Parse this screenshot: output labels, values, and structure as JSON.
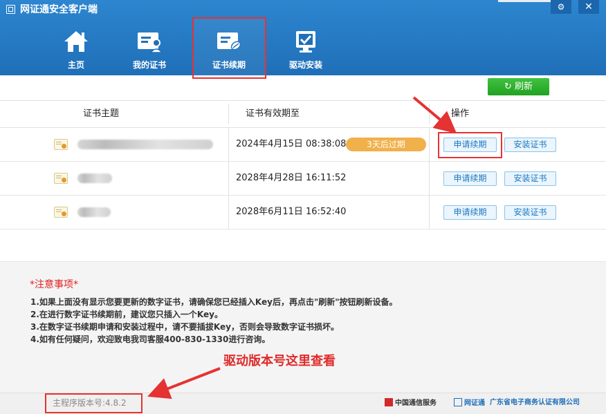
{
  "app": {
    "title": "网证通安全客户端"
  },
  "nav": [
    {
      "label": "主页",
      "icon": "home-icon"
    },
    {
      "label": "我的证书",
      "icon": "certificate-user-icon"
    },
    {
      "label": "证书续期",
      "icon": "certificate-renew-icon",
      "active": true
    },
    {
      "label": "驱动安装",
      "icon": "driver-install-icon"
    }
  ],
  "toolbar": {
    "refresh_label": "刷新"
  },
  "table": {
    "headers": [
      "证书主题",
      "证书有效期至",
      "操作"
    ],
    "rows": [
      {
        "expiry": "2024年4月15日 08:38:08",
        "badge": "3天后过期",
        "renew": "申请续期",
        "install": "安装证书"
      },
      {
        "expiry": "2028年4月28日 16:11:52",
        "renew": "申请续期",
        "install": "安装证书"
      },
      {
        "expiry": "2028年6月11日 16:52:40",
        "renew": "申请续期",
        "install": "安装证书"
      }
    ]
  },
  "notes": {
    "star": "*",
    "title": "注意事项",
    "lines": [
      "1.如果上面没有显示您要更新的数字证书，请确保您已经插入Key后，再点击\"刷新\"按钮刷新设备。",
      "2.在进行数字证书续期前，建议您只插入一个Key。",
      "3.在数字证书续期申请和安装过程中，请不要插拔Key，否则会导致数字证书损坏。",
      "4.如有任何疑问，欢迎致电我司客服400-830-1330进行咨询。"
    ]
  },
  "annotation": {
    "text": "驱动版本号这里查看"
  },
  "footer": {
    "version": "主程序版本号:4.8.2",
    "partners": [
      "中国通信服务",
      "网证通",
      "广东省电子商务认证有限公司"
    ]
  },
  "colors": {
    "header": "#1f6fb8",
    "accent_red": "#e53232",
    "refresh_green": "#22a122",
    "badge_orange": "#f0b04a"
  }
}
